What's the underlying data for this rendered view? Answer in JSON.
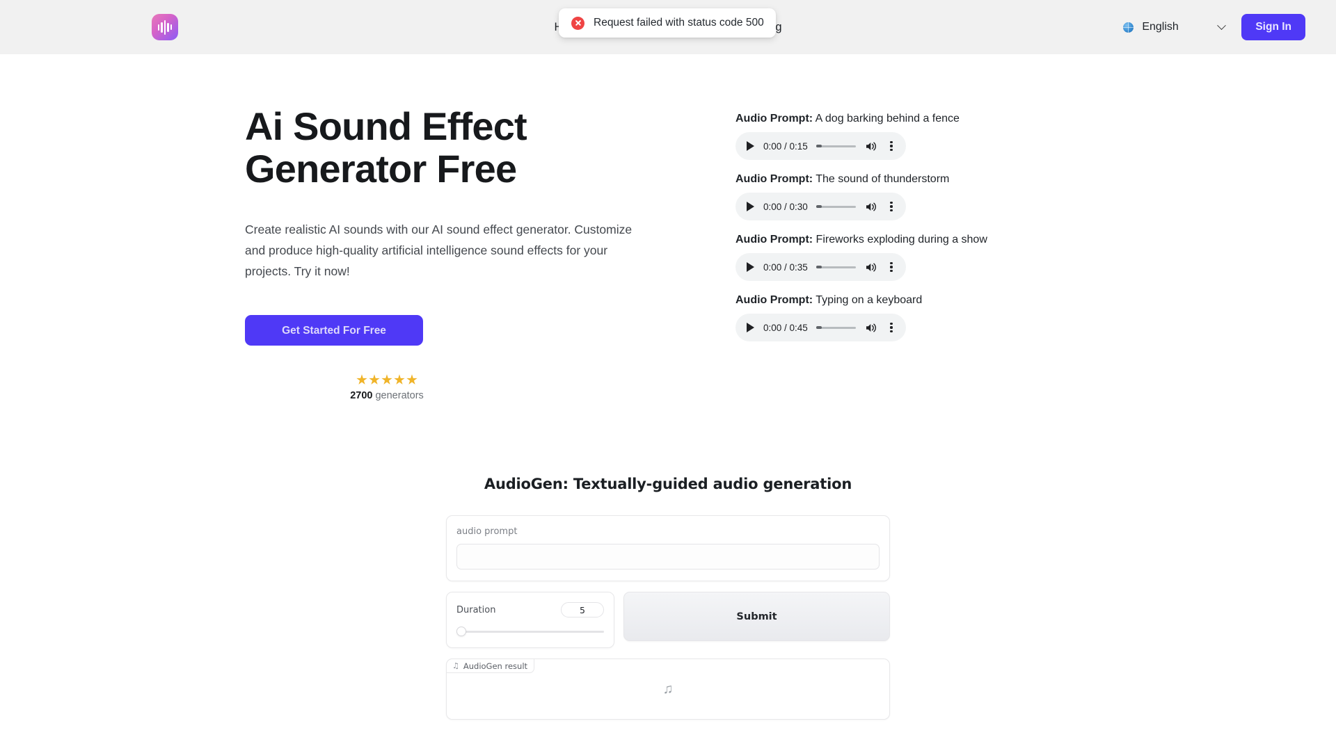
{
  "header": {
    "logo_icon": "audio-waveform-logo",
    "nav": [
      {
        "label": "Home"
      },
      {
        "label": "Blog"
      }
    ],
    "toast": {
      "icon": "error-circle-x-icon",
      "message": "Request failed with status code 500"
    },
    "language": {
      "icon": "globe-icon",
      "selected": "English",
      "chevron": "chevron-down-icon"
    },
    "signin_label": "Sign In"
  },
  "hero": {
    "title": "Ai Sound Effect Generator Free",
    "subtitle": "Create realistic AI sounds with our AI sound effect generator. Customize and produce high-quality artificial intelligence sound effects for your projects. Try it now!",
    "cta_label": "Get Started For Free",
    "rating": {
      "stars": 5,
      "count": "2700",
      "count_suffix": " generators"
    }
  },
  "samples": {
    "prompt_prefix": "Audio Prompt:",
    "items": [
      {
        "prompt": " A dog barking behind a fence",
        "current_time": "0:00",
        "duration": "0:15",
        "time_display": "0:00 / 0:15",
        "progress_pct": 3
      },
      {
        "prompt": " The sound of thunderstorm",
        "current_time": "0:00",
        "duration": "0:30",
        "time_display": "0:00 / 0:30",
        "progress_pct": 3
      },
      {
        "prompt": " Fireworks exploding during a show",
        "current_time": "0:00",
        "duration": "0:35",
        "time_display": "0:00 / 0:35",
        "progress_pct": 3
      },
      {
        "prompt": " Typing on a keyboard",
        "current_time": "0:00",
        "duration": "0:45",
        "time_display": "0:00 / 0:45",
        "progress_pct": 3
      }
    ]
  },
  "gradio": {
    "title": "AudioGen: Textually-guided audio generation",
    "prompt_field": {
      "label": "audio prompt",
      "value": "",
      "placeholder": ""
    },
    "duration": {
      "label": "Duration",
      "value": "5",
      "slider_pct": 0
    },
    "submit_label": "Submit",
    "result": {
      "tag_icon": "music-note-icon",
      "tag_label": "AudioGen result",
      "empty_icon": "music-note-icon"
    }
  },
  "colors": {
    "accent_purple": "#4f39f6",
    "header_bg": "#f1f1f1",
    "error_red": "#ef4444",
    "star_gold": "#f0b429"
  }
}
